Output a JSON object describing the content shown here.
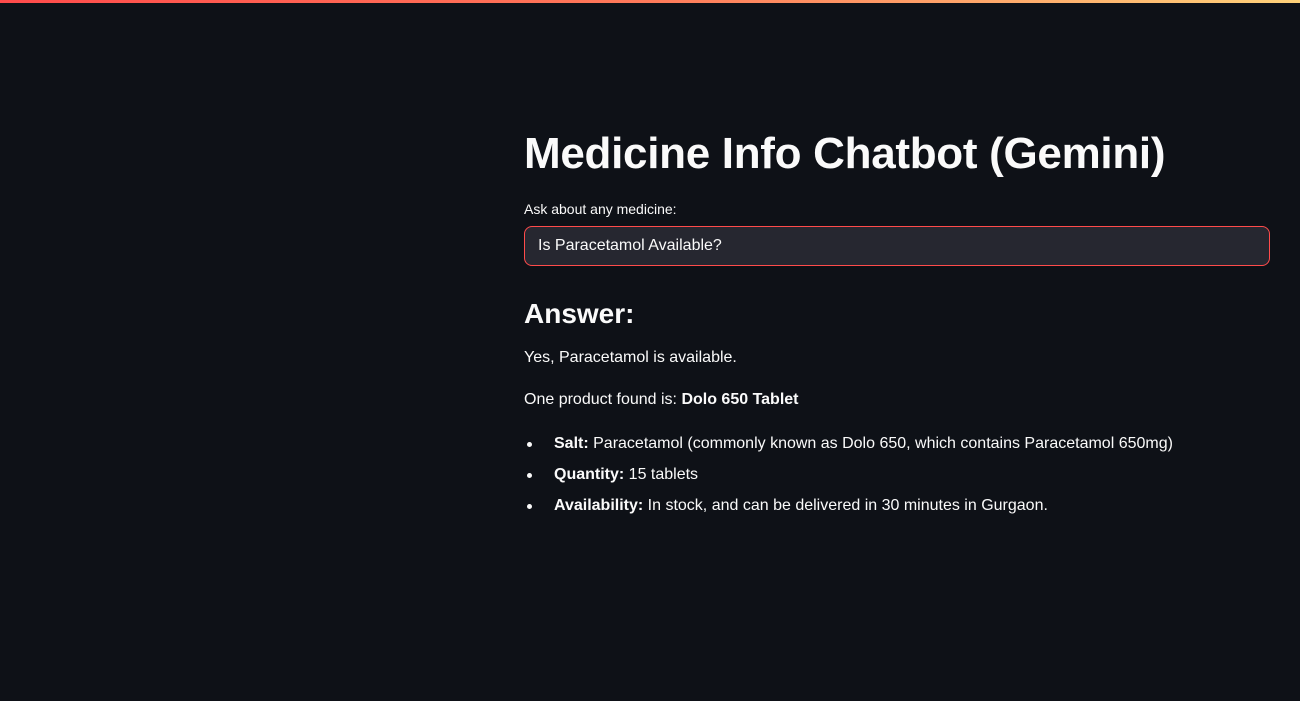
{
  "colors": {
    "background": "#0e1117",
    "input_background": "#262730",
    "input_border_focus": "#ff4b4b",
    "text": "#fafafa",
    "top_bar_gradient": [
      "#ff4b4b",
      "#ffd27a"
    ]
  },
  "title": "Medicine Info Chatbot (Gemini)",
  "query": {
    "label": "Ask about any medicine:",
    "value": "Is Paracetamol Available?"
  },
  "answer": {
    "heading": "Answer:",
    "line1": "Yes, Paracetamol is available.",
    "line2_prefix": "One product found is: ",
    "product_name": "Dolo 650 Tablet",
    "details": [
      {
        "label": "Salt:",
        "value": " Paracetamol (commonly known as Dolo 650, which contains Paracetamol 650mg)"
      },
      {
        "label": "Quantity:",
        "value": " 15 tablets"
      },
      {
        "label": "Availability:",
        "value": " In stock, and can be delivered in 30 minutes in Gurgaon."
      }
    ]
  }
}
